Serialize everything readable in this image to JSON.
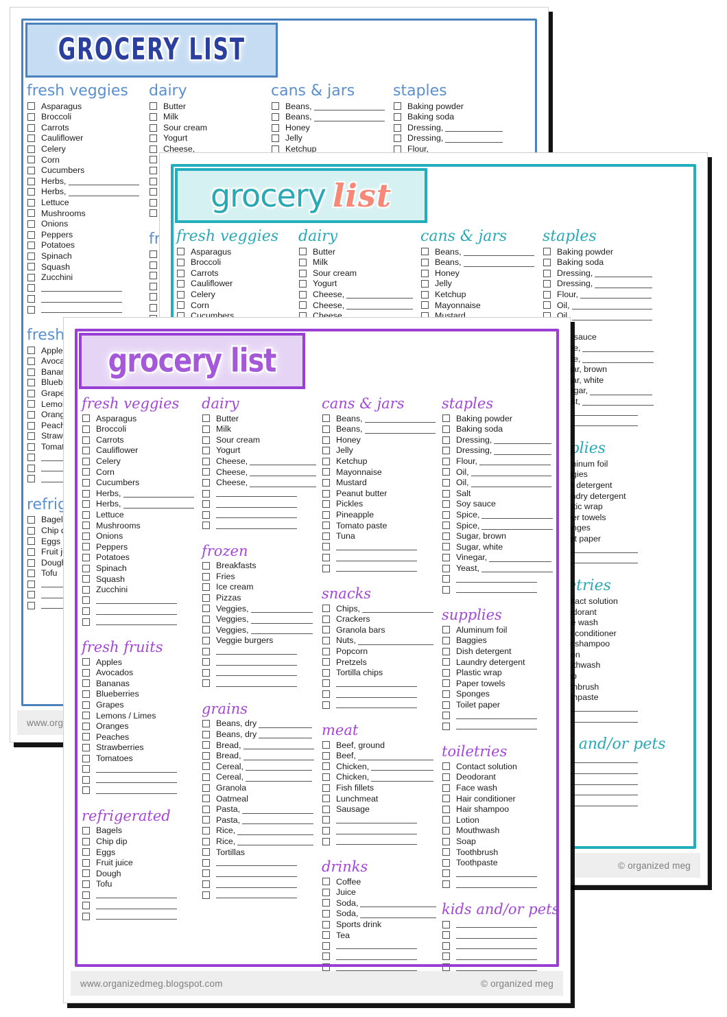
{
  "colors": {
    "blue_accent": "#4a82bd",
    "blue_title": "#2b3f9e",
    "blue_heading": "#5b8fd0",
    "teal_accent": "#23aebb",
    "teal_heading": "#2aa9b5",
    "coral": "#f58877",
    "purple_accent": "#9a3fd4",
    "purple_heading": "#a347d8",
    "page_bg": "#ffffff",
    "mat_bg": "#eeeeee",
    "footer_text": "#7d7d7d"
  },
  "footer": {
    "url": "www.organizedmeg.blogspot.com",
    "copyright": "© organized meg"
  },
  "sheets": {
    "blue": {
      "style_name": "blue-varsity",
      "title": "GROCERY LIST",
      "title_words": [
        "GROCERY",
        "LIST"
      ]
    },
    "teal": {
      "style_name": "teal-script",
      "title": "grocery list",
      "title_words": [
        "grocery",
        "list"
      ]
    },
    "purple": {
      "style_name": "purple-bubble",
      "title": "grocery list",
      "title_words": [
        "grocery",
        "list"
      ]
    }
  },
  "categories": {
    "fresh_veggies": {
      "heading": "fresh veggies",
      "items": [
        "Asparagus",
        "Broccoli",
        "Carrots",
        "Cauliflower",
        "Celery",
        "Corn",
        "Cucumbers",
        "Herbs, ____",
        "Herbs, ____",
        "Lettuce",
        "Mushrooms",
        "Onions",
        "Peppers",
        "Potatoes",
        "Spinach",
        "Squash",
        "Zucchini"
      ],
      "blank_lines": 3
    },
    "fresh_fruits": {
      "heading": "fresh fruits",
      "items": [
        "Apples",
        "Avocados",
        "Bananas",
        "Blueberries",
        "Grapes",
        "Lemons / Limes",
        "Oranges",
        "Peaches",
        "Strawberries",
        "Tomatoes"
      ],
      "blank_lines": 3
    },
    "refrigerated": {
      "heading": "refrigerated",
      "items": [
        "Bagels",
        "Chip dip",
        "Eggs",
        "Fruit juice",
        "Dough",
        "Tofu"
      ],
      "blank_lines": 3
    },
    "dairy": {
      "heading": "dairy",
      "items": [
        "Butter",
        "Milk",
        "Sour cream",
        "Yogurt",
        "Cheese, ____",
        "Cheese, ____",
        "Cheese, ____"
      ],
      "blank_lines": 4
    },
    "frozen": {
      "heading": "frozen",
      "items": [
        "Breakfasts",
        "Fries",
        "Ice cream",
        "Pizzas",
        "Veggies, ____",
        "Veggies, ____",
        "Veggies, ____",
        "Veggie burgers"
      ],
      "blank_lines": 4
    },
    "grains": {
      "heading": "grains",
      "items": [
        "Beans, dry ____",
        "Beans, dry ____",
        "Bread, ____",
        "Bread, ____",
        "Cereal, ____",
        "Cereal, ____",
        "Granola",
        "Oatmeal",
        "Pasta, ____",
        "Pasta, ____",
        "Rice, ____",
        "Rice, ____",
        "Tortillas"
      ],
      "blank_lines": 4
    },
    "cans_jars": {
      "heading": "cans & jars",
      "items": [
        "Beans, ____",
        "Beans, ____",
        "Honey",
        "Jelly",
        "Ketchup",
        "Mayonnaise",
        "Mustard",
        "Peanut butter",
        "Pickles",
        "Pineapple",
        "Tomato paste",
        "Tuna"
      ],
      "blank_lines": 3
    },
    "snacks": {
      "heading": "snacks",
      "items": [
        "Chips, ____",
        "Crackers",
        "Granola bars",
        "Nuts, ____",
        "Popcorn",
        "Pretzels",
        "Tortilla chips"
      ],
      "blank_lines": 3
    },
    "meat": {
      "heading": "meat",
      "items": [
        "Beef, ground",
        "Beef, ____",
        "Chicken, ____",
        "Chicken, ____",
        "Fish fillets",
        "Lunchmeat",
        "Sausage"
      ],
      "blank_lines": 3
    },
    "drinks": {
      "heading": "drinks",
      "items": [
        "Coffee",
        "Juice",
        "Soda, ____",
        "Soda, ____",
        "Sports drink",
        "Tea"
      ],
      "blank_lines": 3
    },
    "staples": {
      "heading": "staples",
      "items": [
        "Baking powder",
        "Baking soda",
        "Dressing, ____",
        "Dressing, ____",
        "Flour, ____",
        "Oil, ____",
        "Oil, ____",
        "Salt",
        "Soy sauce",
        "Spice, ____",
        "Spice, ____",
        "Sugar, brown",
        "Sugar, white",
        "Vinegar, ____",
        "Yeast, ____"
      ],
      "blank_lines": 2
    },
    "supplies": {
      "heading": "supplies",
      "items": [
        "Aluminum foil",
        "Baggies",
        "Dish detergent",
        "Laundry detergent",
        "Plastic wrap",
        "Paper towels",
        "Sponges",
        "Toilet paper"
      ],
      "blank_lines": 2
    },
    "toiletries": {
      "heading": "toiletries",
      "items": [
        "Contact solution",
        "Deodorant",
        "Face wash",
        "Hair conditioner",
        "Hair shampoo",
        "Lotion",
        "Mouthwash",
        "Soap",
        "Toothbrush",
        "Toothpaste"
      ],
      "blank_lines": 2
    },
    "kids_pets": {
      "heading": "kids and/or pets",
      "items": [],
      "blank_lines": 5
    }
  },
  "layout": {
    "columns": [
      [
        "fresh_veggies",
        "fresh_fruits",
        "refrigerated"
      ],
      [
        "dairy",
        "frozen",
        "grains"
      ],
      [
        "cans_jars",
        "snacks",
        "meat",
        "drinks"
      ],
      [
        "staples",
        "supplies",
        "toiletries",
        "kids_pets"
      ]
    ]
  }
}
